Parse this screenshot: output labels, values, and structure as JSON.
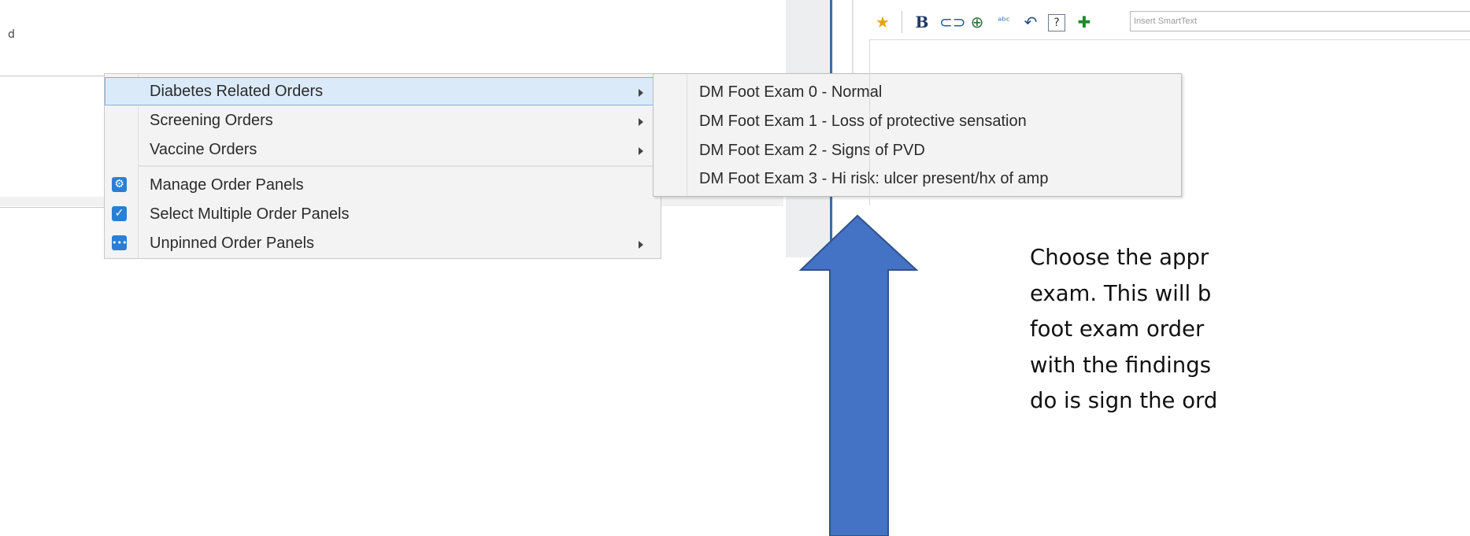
{
  "background": {
    "stray_char": "d"
  },
  "main_menu": {
    "items": [
      {
        "label": "Diabetes Related Orders",
        "has_submenu": true,
        "highlighted": true,
        "icon": null
      },
      {
        "label": "Screening Orders",
        "has_submenu": true,
        "highlighted": false,
        "icon": null
      },
      {
        "label": "Vaccine Orders",
        "has_submenu": true,
        "highlighted": false,
        "icon": null
      },
      {
        "label": "Manage Order Panels",
        "has_submenu": false,
        "highlighted": false,
        "icon": "gear-icon"
      },
      {
        "label": "Select Multiple Order Panels",
        "has_submenu": false,
        "highlighted": false,
        "icon": "checkbox-icon"
      },
      {
        "label": "Unpinned Order Panels",
        "has_submenu": true,
        "highlighted": false,
        "icon": "more-icon"
      }
    ]
  },
  "sub_menu": {
    "items": [
      {
        "label": "DM Foot Exam 0 - Normal"
      },
      {
        "label": "DM Foot Exam 1 - Loss of protective sensation"
      },
      {
        "label": "DM Foot Exam 2 - Signs of PVD"
      },
      {
        "label": "DM Foot Exam 3 - Hi risk: ulcer present/hx of amp"
      }
    ]
  },
  "toolbar": {
    "icons": [
      "star-icon",
      "bold-icon",
      "link-icon",
      "zoom-icon",
      "spellcheck-icon",
      "undo-icon",
      "help-icon",
      "add-icon"
    ],
    "smarttext_placeholder": "Insert SmartText"
  },
  "caption": {
    "lines": [
      "Choose the appr",
      "exam. This will b",
      "foot exam order",
      "with the findings",
      "do is sign the ord"
    ]
  },
  "colors": {
    "arrow_fill": "#4472c4",
    "arrow_stroke": "#2f528f",
    "highlight_bg": "#dbeaf9",
    "menu_bg": "#f3f3f3",
    "icon_blue": "#2a7fd4"
  }
}
